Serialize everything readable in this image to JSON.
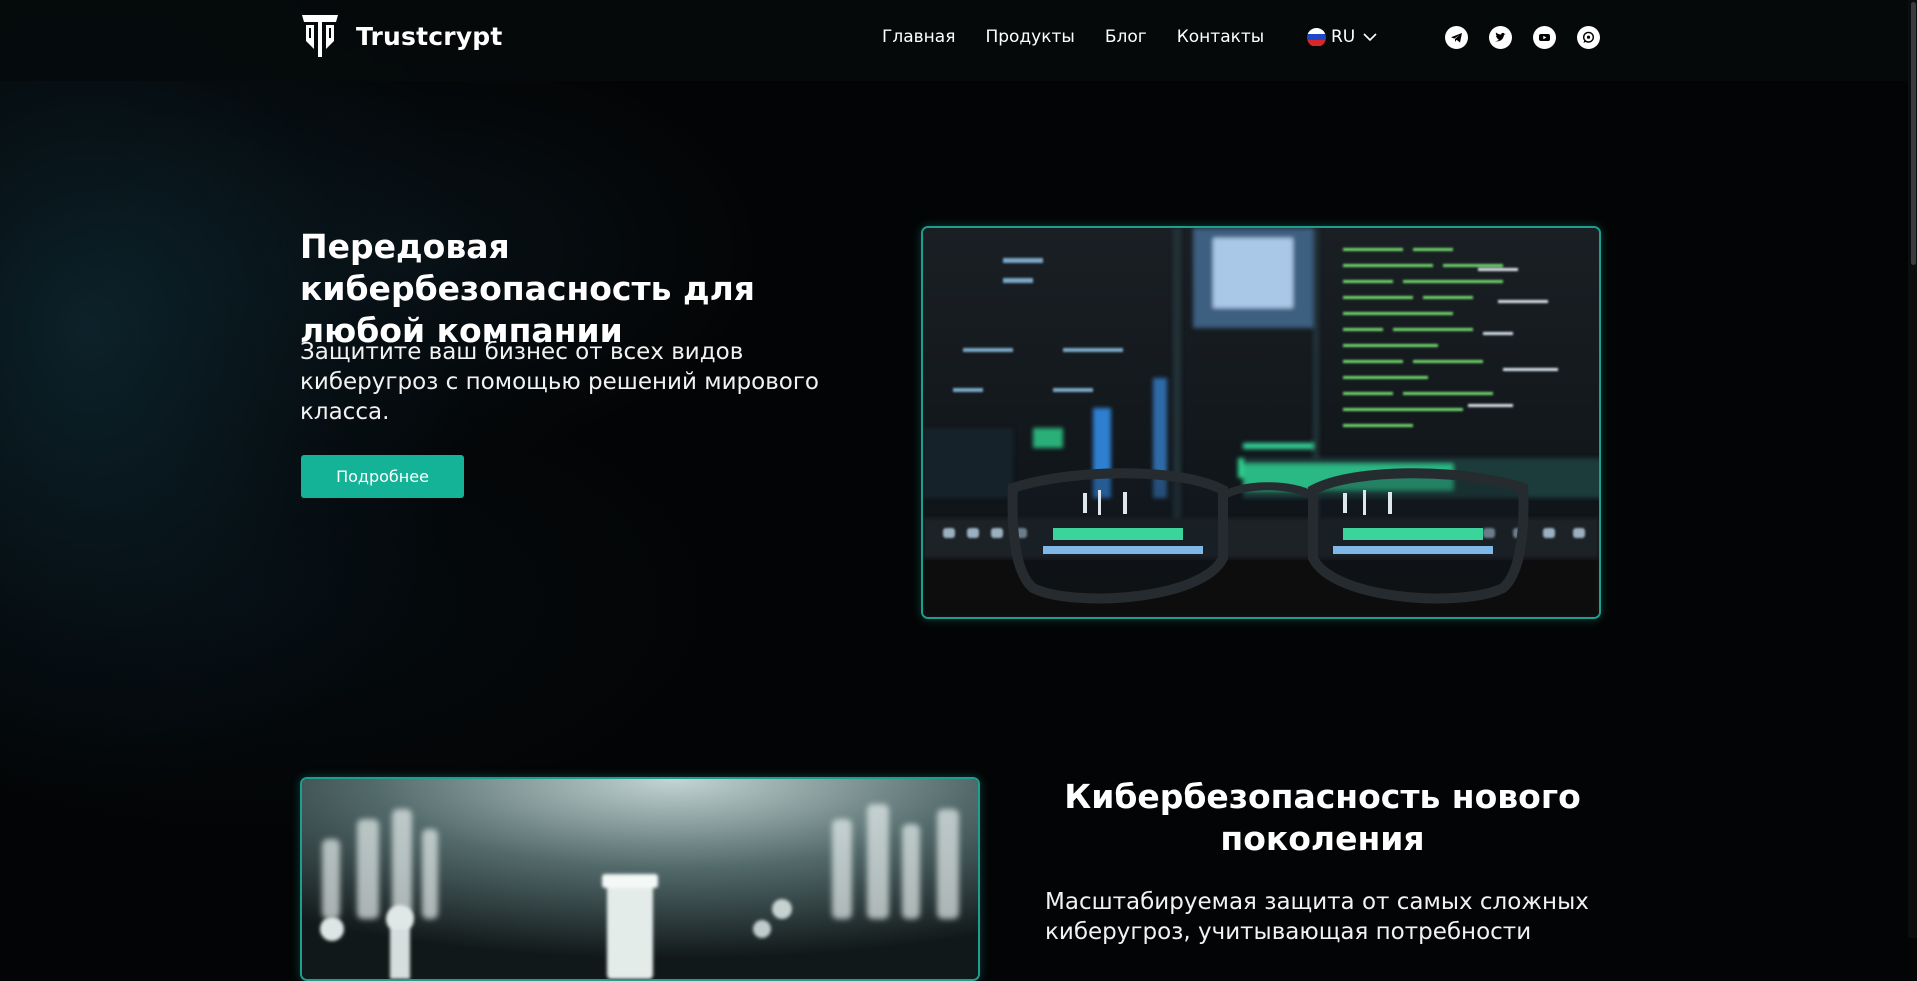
{
  "brand": {
    "name": "Trustcrypt"
  },
  "nav": {
    "items": [
      {
        "label": "Главная"
      },
      {
        "label": "Продукты"
      },
      {
        "label": "Блог"
      },
      {
        "label": "Контакты"
      }
    ]
  },
  "language": {
    "code": "RU",
    "flag_icon": "russia-flag-icon"
  },
  "social": [
    "telegram-icon",
    "twitter-icon",
    "youtube-icon",
    "whatsapp-icon"
  ],
  "hero": {
    "title": "Передовая кибербезопасность для любой компании",
    "subtitle": "Защитите ваш бизнес от всех видов киберугроз с помощью решений мирового класса.",
    "button_label": "Подробнее"
  },
  "section2": {
    "title": "Кибербезопасность нового поколения",
    "text": "Масштабируемая защита от самых сложных киберугроз, учитывающая потребности"
  },
  "colors": {
    "accent": "#14b296",
    "background": "#030405",
    "frame": "#1c9f8f"
  }
}
